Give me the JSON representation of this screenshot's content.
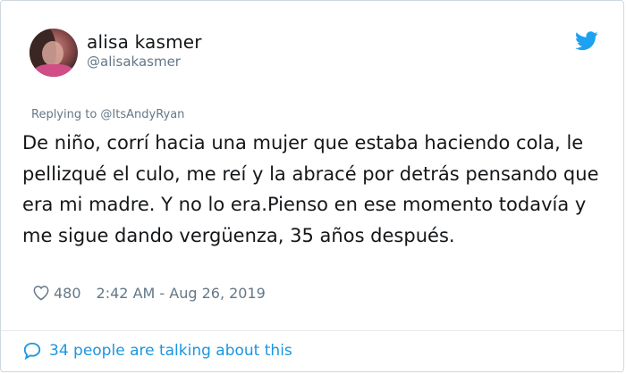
{
  "tweet": {
    "author": {
      "name": "alisa kasmer",
      "handle": "@alisakasmer"
    },
    "replying_to": "Replying to @ItsAndyRyan",
    "text": "De niño, corrí hacia una mujer que estaba haciendo cola, le pellizqué el culo, me reí y la abracé por detrás pensando que era mi madre. Y no lo era.Pienso en ese momento todavía y me sigue dando vergüenza, 35 años después.",
    "likes": "480",
    "timestamp": "2:42 AM - Aug 26, 2019",
    "conversation": "34 people are talking about this"
  },
  "icons": {
    "brand": "twitter-bird-icon",
    "like": "heart-icon",
    "conversation": "speech-bubble-icon"
  },
  "colors": {
    "brand_blue": "#1da1f2",
    "link_blue": "#1b95e0",
    "text": "#14171a",
    "secondary": "#657786",
    "border": "#cfd9de"
  }
}
